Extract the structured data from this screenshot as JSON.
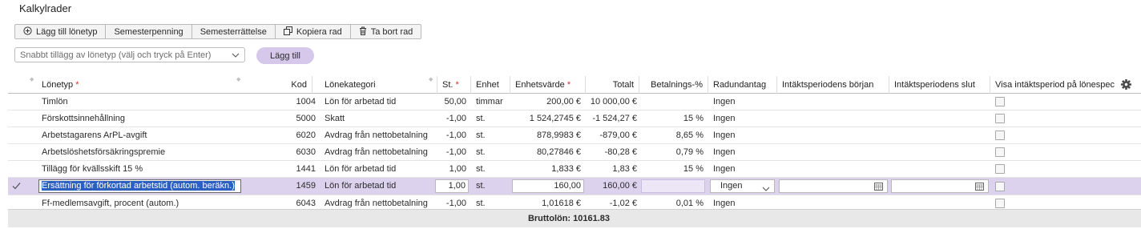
{
  "title": "Kalkylrader",
  "toolbar": {
    "add_wage_type": "Lägg till lönetyp",
    "vacation_pay": "Semesterpenning",
    "vacation_correction": "Semesterrättelse",
    "copy_row": "Kopiera rad",
    "delete_row": "Ta bort rad"
  },
  "quick_add": {
    "placeholder": "Snabbt tillägg av lönetyp (välj och tryck på Enter)",
    "add_button": "Lägg till"
  },
  "columns": {
    "lonetyp": "Lönetyp",
    "kod": "Kod",
    "lonekategori": "Lönekategori",
    "st": "St.",
    "enhet": "Enhet",
    "enhetsvarde": "Enhetsvärde",
    "totalt": "Totalt",
    "betalnings": "Betalnings-%",
    "radundantag": "Radundantag",
    "intakt_borjan": "Intäktsperiodens början",
    "intakt_slut": "Intäktsperiodens slut",
    "visa": "Visa intäktsperiod på lönespec"
  },
  "required_marker": "*",
  "rows": [
    {
      "lonetyp": "Timlön",
      "kod": "1004",
      "kategori": "Lön för arbetad tid",
      "st": "50,00",
      "enhet": "timmar",
      "enhetsvarde": "200,00 €",
      "totalt": "10 000,00 €",
      "betalnings": "",
      "radundantag": "Ingen"
    },
    {
      "lonetyp": "Förskottsinnehållning",
      "kod": "5000",
      "kategori": "Skatt",
      "st": "-1,00",
      "enhet": "st.",
      "enhetsvarde": "1 524,2745 €",
      "totalt": "-1 524,27 €",
      "betalnings": "15 %",
      "radundantag": "Ingen"
    },
    {
      "lonetyp": "Arbetstagarens ArPL-avgift",
      "kod": "6020",
      "kategori": "Avdrag från nettobetalning",
      "st": "-1,00",
      "enhet": "st.",
      "enhetsvarde": "878,9983 €",
      "totalt": "-879,00 €",
      "betalnings": "8,65 %",
      "radundantag": "Ingen"
    },
    {
      "lonetyp": "Arbetslöshetsförsäkringspremie",
      "kod": "6030",
      "kategori": "Avdrag från nettobetalning",
      "st": "-1,00",
      "enhet": "st.",
      "enhetsvarde": "80,27846 €",
      "totalt": "-80,28 €",
      "betalnings": "0,79 %",
      "radundantag": "Ingen"
    },
    {
      "lonetyp": "Tillägg för kvällsskift 15 %",
      "kod": "1441",
      "kategori": "Lön för arbetad tid",
      "st": "1,00",
      "enhet": "st.",
      "enhetsvarde": "1,833 €",
      "totalt": "1,83 €",
      "betalnings": "15 %",
      "radundantag": "Ingen"
    },
    {
      "lonetyp": "Ersättning för förkortad arbetstid (autom. beräkn.)",
      "kod": "1459",
      "kategori": "Lön för arbetad tid",
      "st": "1,00",
      "enhet": "st.",
      "enhetsvarde": "160,00",
      "totalt": "160,00 €",
      "betalnings": "",
      "radundantag": "Ingen"
    },
    {
      "lonetyp": "Ff-medlemsavgift, procent (autom.)",
      "kod": "6043",
      "kategori": "Avdrag från nettobetalning",
      "st": "-1,00",
      "enhet": "st.",
      "enhetsvarde": "1,01618 €",
      "totalt": "-1,02 €",
      "betalnings": "0,01 %",
      "radundantag": "Ingen"
    }
  ],
  "selected_row": 5,
  "footer": {
    "bruttolon": "Bruttolön: 10161.83"
  },
  "icons": {
    "add": "plus-circle-icon",
    "copy": "copy-icon",
    "delete": "trash-icon",
    "settings": "gear-icon",
    "calendar": "calendar-icon",
    "check": "check-icon",
    "dropdown": "chevron-down-icon"
  },
  "colors": {
    "accent": "#d6c8ea",
    "selected_row": "#ddd2ee",
    "required": "#d0312d"
  }
}
